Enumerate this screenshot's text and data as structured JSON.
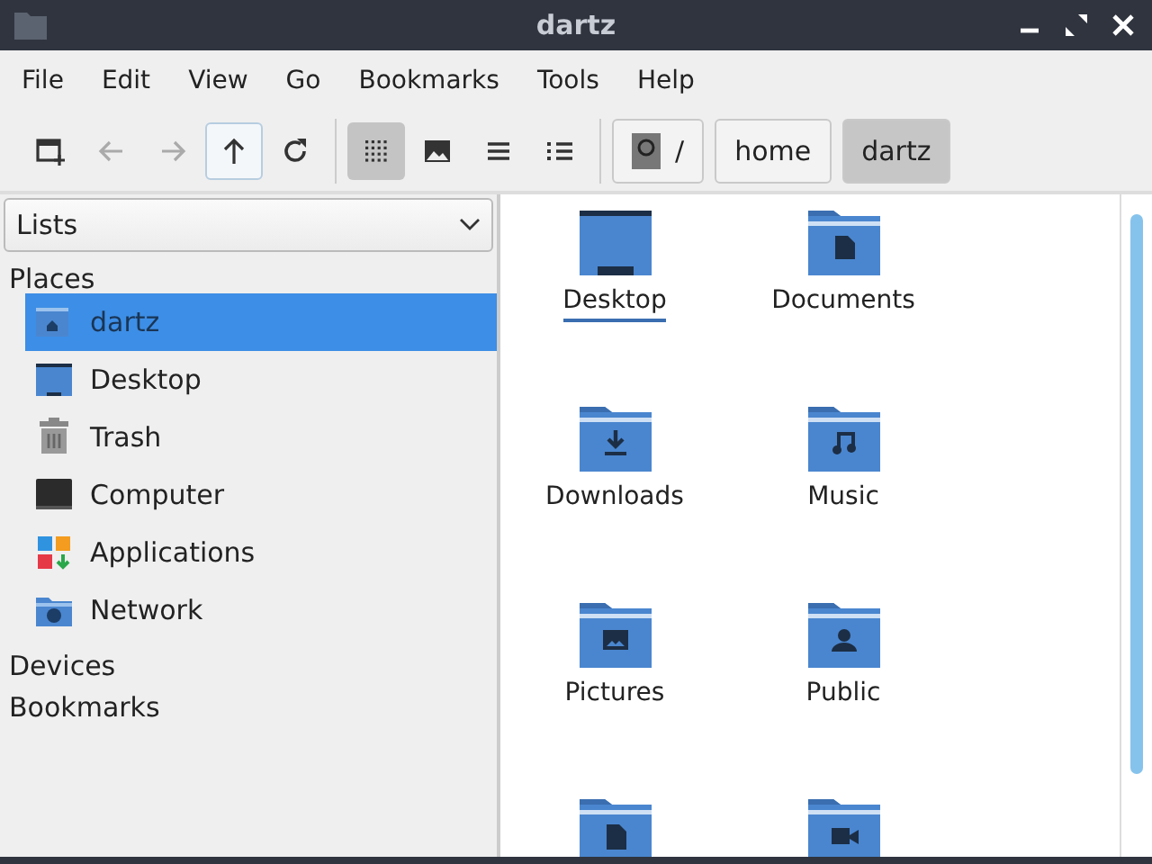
{
  "window": {
    "title": "dartz"
  },
  "menu": [
    "File",
    "Edit",
    "View",
    "Go",
    "Bookmarks",
    "Tools",
    "Help"
  ],
  "toolbar": {
    "nav": [
      {
        "kind": "new-tab",
        "disabled": false
      },
      {
        "kind": "back",
        "disabled": true
      },
      {
        "kind": "forward",
        "disabled": true
      },
      {
        "kind": "up",
        "disabled": false
      },
      {
        "kind": "reload",
        "disabled": false
      }
    ],
    "views": [
      {
        "kind": "icons",
        "selected": true
      },
      {
        "kind": "thumbnails",
        "selected": false
      },
      {
        "kind": "compact",
        "selected": false
      },
      {
        "kind": "detailed",
        "selected": false
      }
    ],
    "path": [
      {
        "kind": "root",
        "label": "/",
        "selected": false
      },
      {
        "kind": "dir",
        "label": "home",
        "selected": false
      },
      {
        "kind": "dir",
        "label": "dartz",
        "selected": true
      }
    ]
  },
  "sidebar": {
    "dropdown": "Lists",
    "sections": [
      {
        "title": "Places",
        "items": [
          {
            "kind": "home",
            "label": "dartz",
            "selected": true
          },
          {
            "kind": "desktop",
            "label": "Desktop",
            "selected": false
          },
          {
            "kind": "trash",
            "label": "Trash",
            "selected": false
          },
          {
            "kind": "computer",
            "label": "Computer",
            "selected": false
          },
          {
            "kind": "applications",
            "label": "Applications",
            "selected": false
          },
          {
            "kind": "network",
            "label": "Network",
            "selected": false
          }
        ]
      },
      {
        "title": "Devices"
      },
      {
        "title": "Bookmarks"
      }
    ]
  },
  "files": [
    {
      "kind": "desktop",
      "name": "Desktop",
      "focused": true
    },
    {
      "kind": "documents",
      "name": "Documents",
      "focused": false
    },
    {
      "kind": "downloads",
      "name": "Downloads",
      "focused": false
    },
    {
      "kind": "music",
      "name": "Music",
      "focused": false
    },
    {
      "kind": "pictures",
      "name": "Pictures",
      "focused": false
    },
    {
      "kind": "public",
      "name": "Public",
      "focused": false
    },
    {
      "kind": "templates",
      "focused": false
    },
    {
      "kind": "videos",
      "focused": false
    }
  ]
}
